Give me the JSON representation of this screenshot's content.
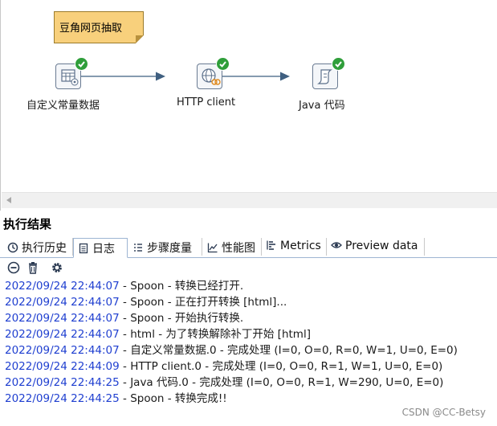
{
  "canvas": {
    "note_text": "豆角网页抽取",
    "steps": [
      {
        "label": "自定义常量数据",
        "icon": "table-generator-icon"
      },
      {
        "label": "HTTP client",
        "icon": "http-client-icon"
      },
      {
        "label": "Java 代码",
        "icon": "script-icon"
      }
    ]
  },
  "results": {
    "title": "执行结果",
    "tabs": [
      {
        "label": "执行历史",
        "icon": "history-icon"
      },
      {
        "label": "日志",
        "icon": "log-icon"
      },
      {
        "label": "步骤度量",
        "icon": "step-metrics-icon"
      },
      {
        "label": "性能图",
        "icon": "performance-chart-icon"
      },
      {
        "label": "Metrics",
        "icon": "metrics-icon"
      },
      {
        "label": "Preview data",
        "icon": "preview-eye-icon"
      }
    ],
    "active_tab": "日志",
    "log": [
      {
        "ts": "2022/09/24 22:44:07",
        "msg": " - Spoon - 转换已经打开."
      },
      {
        "ts": "2022/09/24 22:44:07",
        "msg": " - Spoon - 正在打开转换 [html]..."
      },
      {
        "ts": "2022/09/24 22:44:07",
        "msg": " - Spoon - 开始执行转换."
      },
      {
        "ts": "2022/09/24 22:44:07",
        "msg": " - html - 为了转换解除补丁开始  [html]"
      },
      {
        "ts": "2022/09/24 22:44:07",
        "msg": " - 自定义常量数据.0 - 完成处理 (I=0, O=0, R=0, W=1, U=0, E=0)"
      },
      {
        "ts": "2022/09/24 22:44:09",
        "msg": " - HTTP client.0 - 完成处理 (I=0, O=0, R=1, W=1, U=0, E=0)"
      },
      {
        "ts": "2022/09/24 22:44:25",
        "msg": " - Java 代码.0 - 完成处理 (I=0, O=0, R=1, W=290, U=0, E=0)"
      },
      {
        "ts": "2022/09/24 22:44:25",
        "msg": " - Spoon - 转换完成!!"
      }
    ]
  },
  "watermark": "CSDN @CC-Betsy",
  "colors": {
    "timestamp": "#1f3fd0",
    "success": "#2f9e3a",
    "note_bg": "#f8d07c",
    "hop": "#3f5f80"
  }
}
